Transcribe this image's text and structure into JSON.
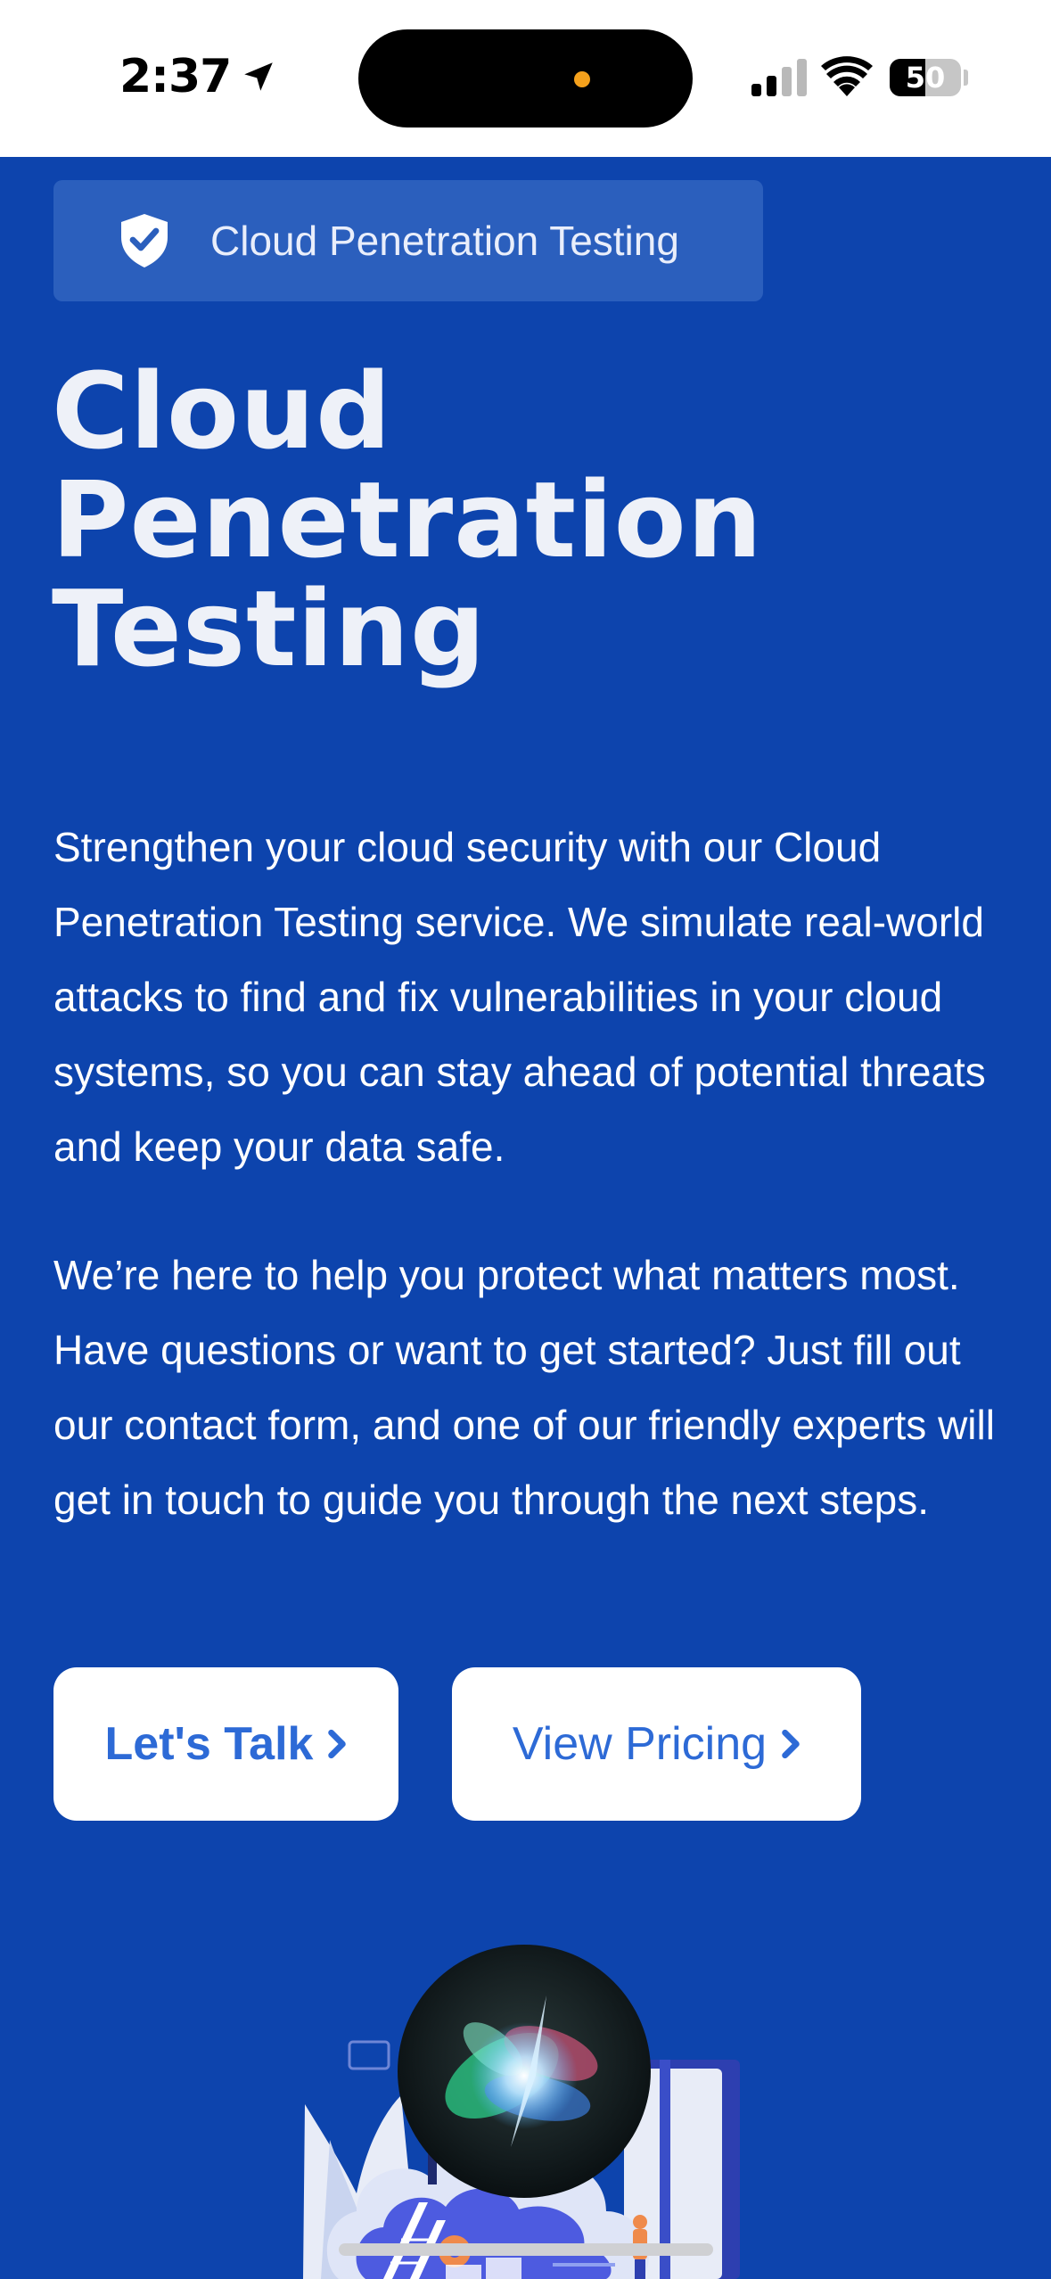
{
  "status_bar": {
    "time": "2:37",
    "battery_level": "50",
    "icons": [
      "location-arrow-icon",
      "cellular-signal-icon",
      "wifi-icon",
      "battery-icon"
    ]
  },
  "hero": {
    "badge_icon": "shield-check-icon",
    "badge_label": "Cloud Penetration Testing",
    "title_lines": [
      "Cloud",
      "Penetration",
      "Testing"
    ],
    "paragraph_1": "Strengthen your cloud security with our Cloud Penetration Testing service. We simulate real-world attacks to find and fix vulnerabilities in your cloud systems, so you can stay ahead of potential threats and keep your data safe.",
    "paragraph_2": "We’re here to help you protect what matters most. Have questions or want to get started? Just fill out our contact form, and one of our friendly experts will get in touch to guide you through the next steps."
  },
  "cta": {
    "talk_label": "Let's Talk",
    "pricing_label": "View Pricing",
    "chevron_icon": "chevron-right-icon"
  },
  "colors": {
    "background": "#0d44ad",
    "badge_bg": "#2b5fbd",
    "button_text": "#2d6ad6",
    "text": "#ffffff"
  }
}
